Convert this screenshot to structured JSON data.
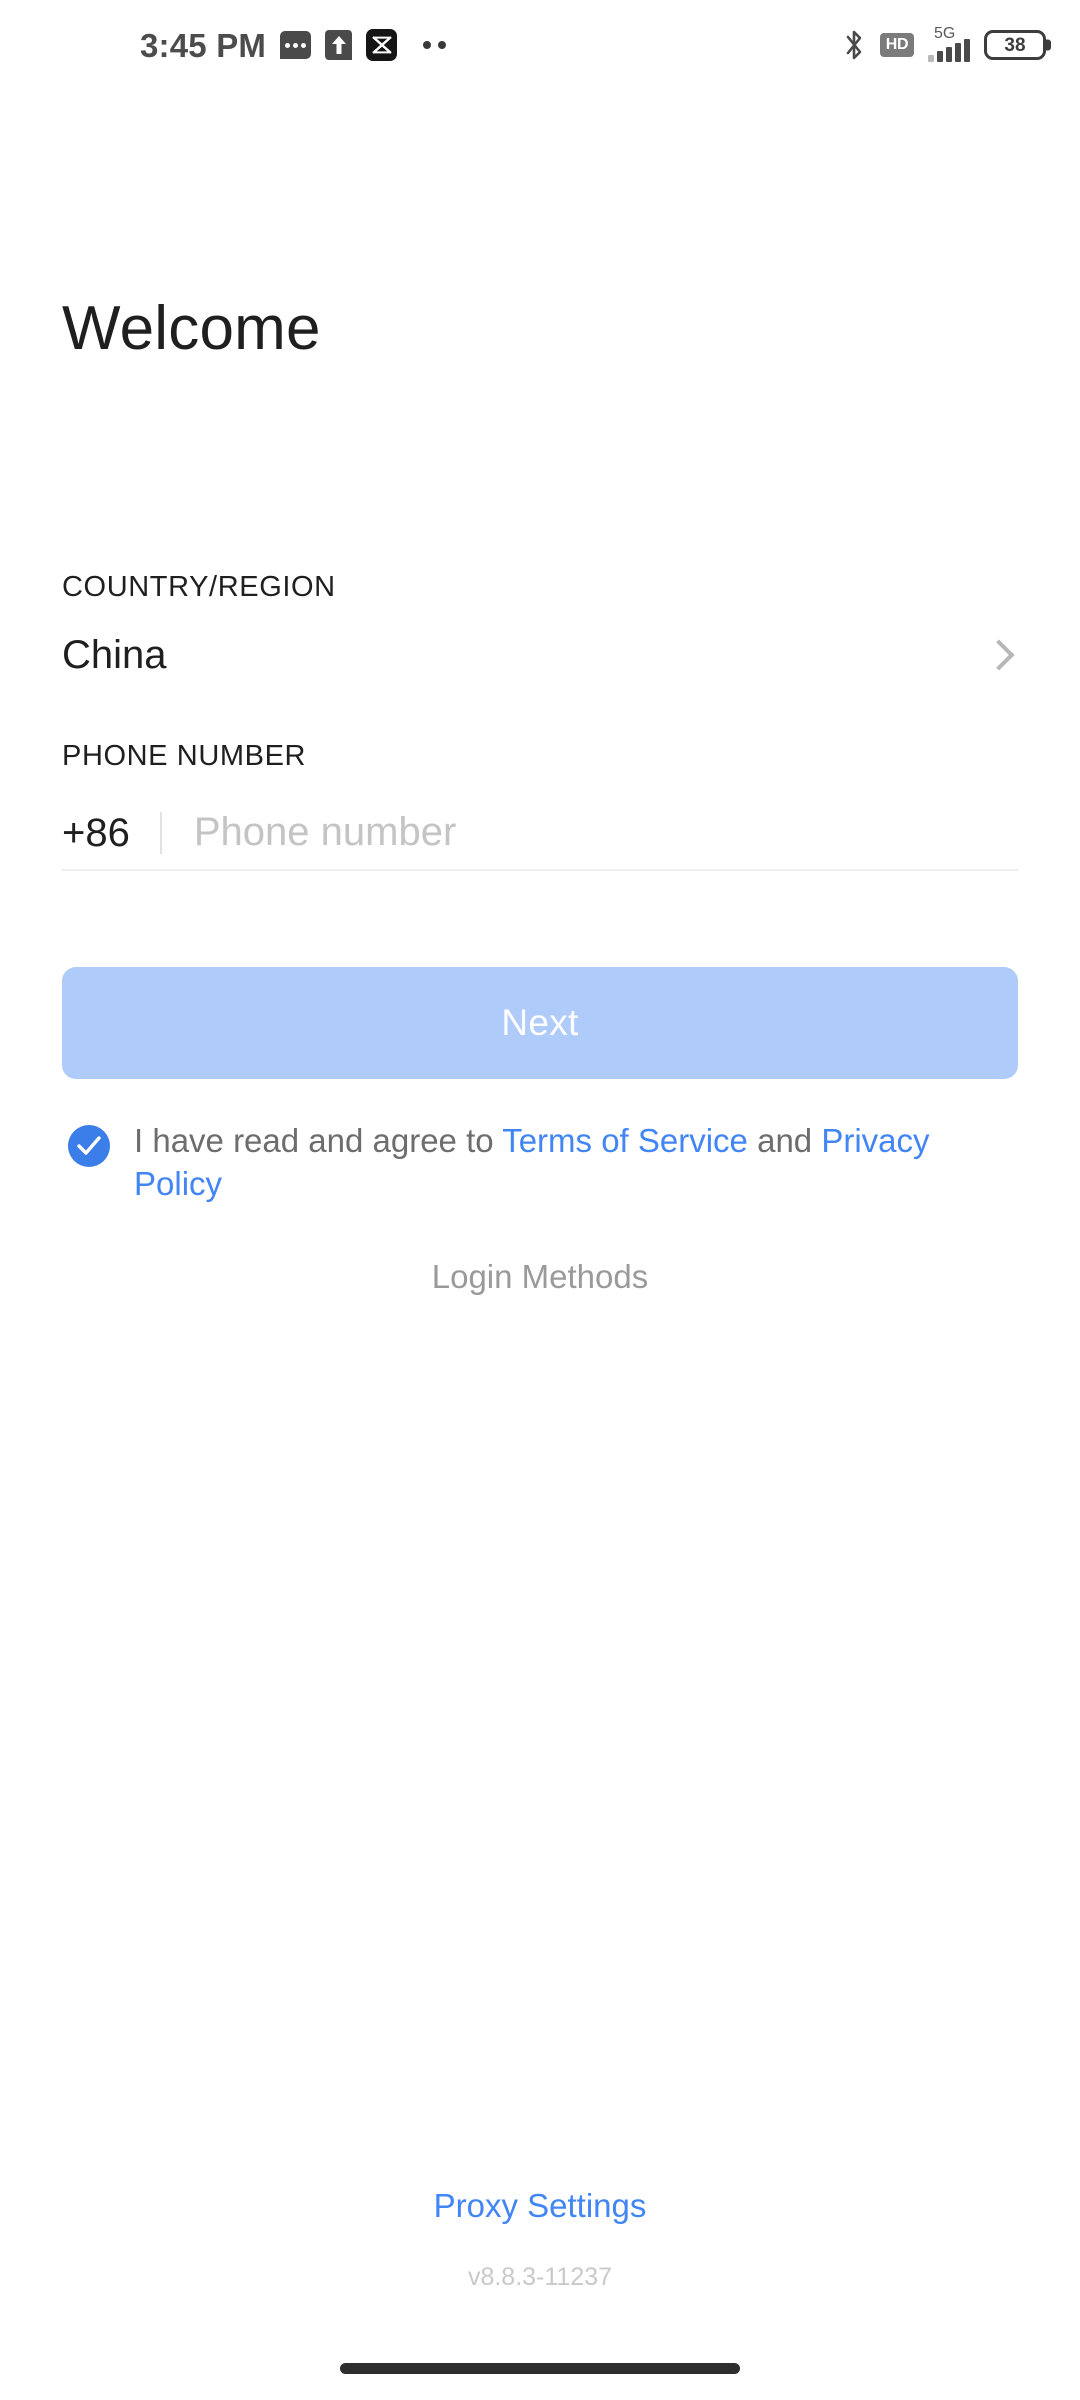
{
  "status_bar": {
    "time": "3:45 PM",
    "left_icons": [
      "message-icon",
      "upload-icon",
      "capcut-app-icon",
      "overflow-dots-icon"
    ],
    "right_icons": [
      "bluetooth-icon",
      "hd-icon",
      "signal-icon",
      "battery-icon"
    ],
    "hd_label": "HD",
    "network_type": "5G",
    "battery_level": "38"
  },
  "page": {
    "title": "Welcome"
  },
  "country": {
    "label": "COUNTRY/REGION",
    "value": "China",
    "chevron_icon": "chevron-right-icon"
  },
  "phone": {
    "label": "PHONE NUMBER",
    "prefix": "+86",
    "placeholder": "Phone number",
    "value": ""
  },
  "actions": {
    "next_label": "Next",
    "next_color": "#aecbfa",
    "login_methods_label": "Login Methods"
  },
  "agreement": {
    "checked": true,
    "checkbox_color": "#3b7de9",
    "prefix_text": "I have read and agree to ",
    "terms_link": "Terms of Service",
    "middle_text": " and ",
    "privacy_link": "Privacy Policy",
    "link_color": "#4285f4"
  },
  "footer": {
    "proxy_settings_label": "Proxy Settings",
    "version": "v8.8.3-11237"
  }
}
